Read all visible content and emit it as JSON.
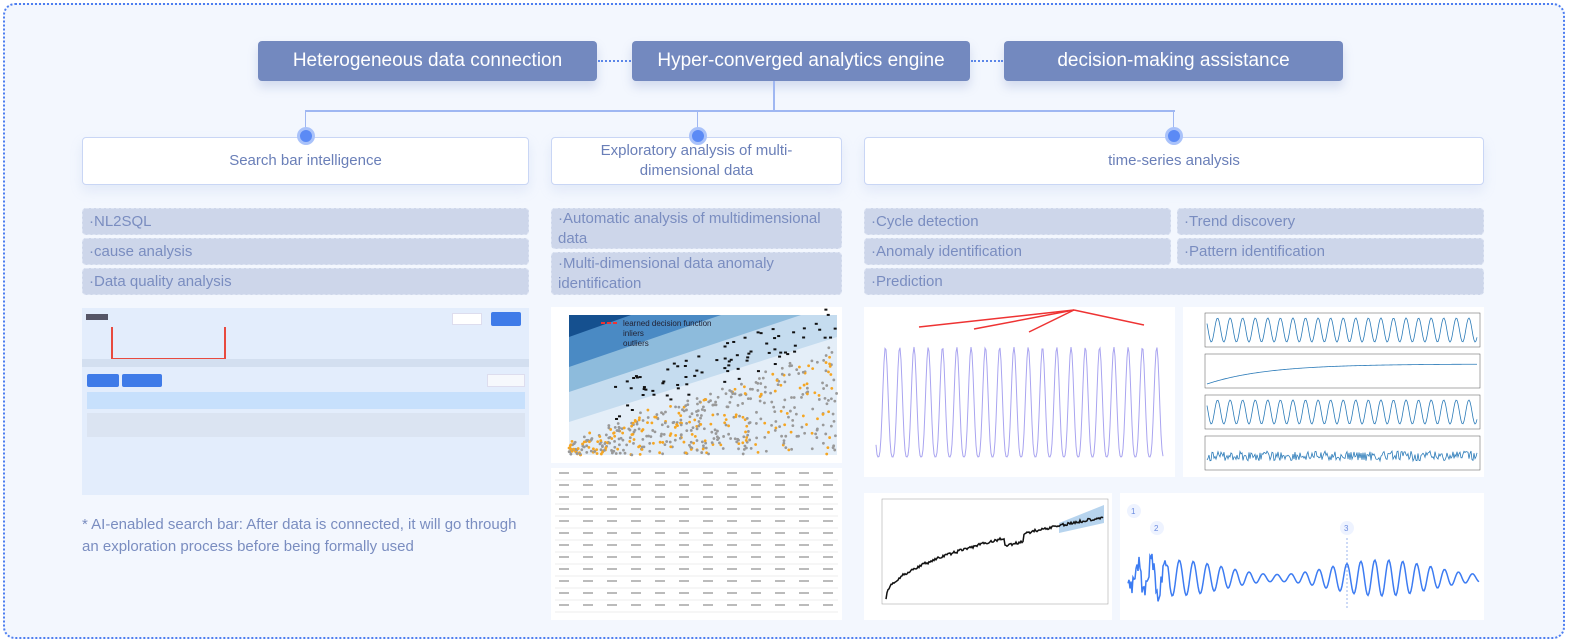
{
  "top_boxes": [
    "Heterogeneous data connection",
    "Hyper-converged analytics engine",
    "decision-making assistance"
  ],
  "columns": [
    {
      "title": "Search bar intelligence",
      "items": [
        "·NL2SQL",
        "·cause analysis",
        "·Data quality analysis"
      ]
    },
    {
      "title": "Exploratory analysis of multi-dimensional data",
      "items": [
        "·Automatic analysis of multidimensional data",
        "·Multi-dimensional data anomaly identification"
      ]
    },
    {
      "title": "time-series analysis",
      "items": [
        "·Cycle detection",
        "·Trend discovery",
        "·Anomaly identification",
        "·Pattern identification",
        "·Prediction"
      ]
    }
  ],
  "note": "* AI-enabled search bar: After data is connected, it will go through an exploration process before being formally used",
  "knn_legend": [
    "learned decision function",
    "inliers",
    "outliers"
  ],
  "wave_markers": [
    "1",
    "2",
    "3"
  ],
  "colors": {
    "top_box": "#7389bf",
    "accent": "#5b8af5",
    "item_bg": "#cdd6ea",
    "text": "#6a7fb8",
    "frame_border": "#4d7ef0"
  }
}
